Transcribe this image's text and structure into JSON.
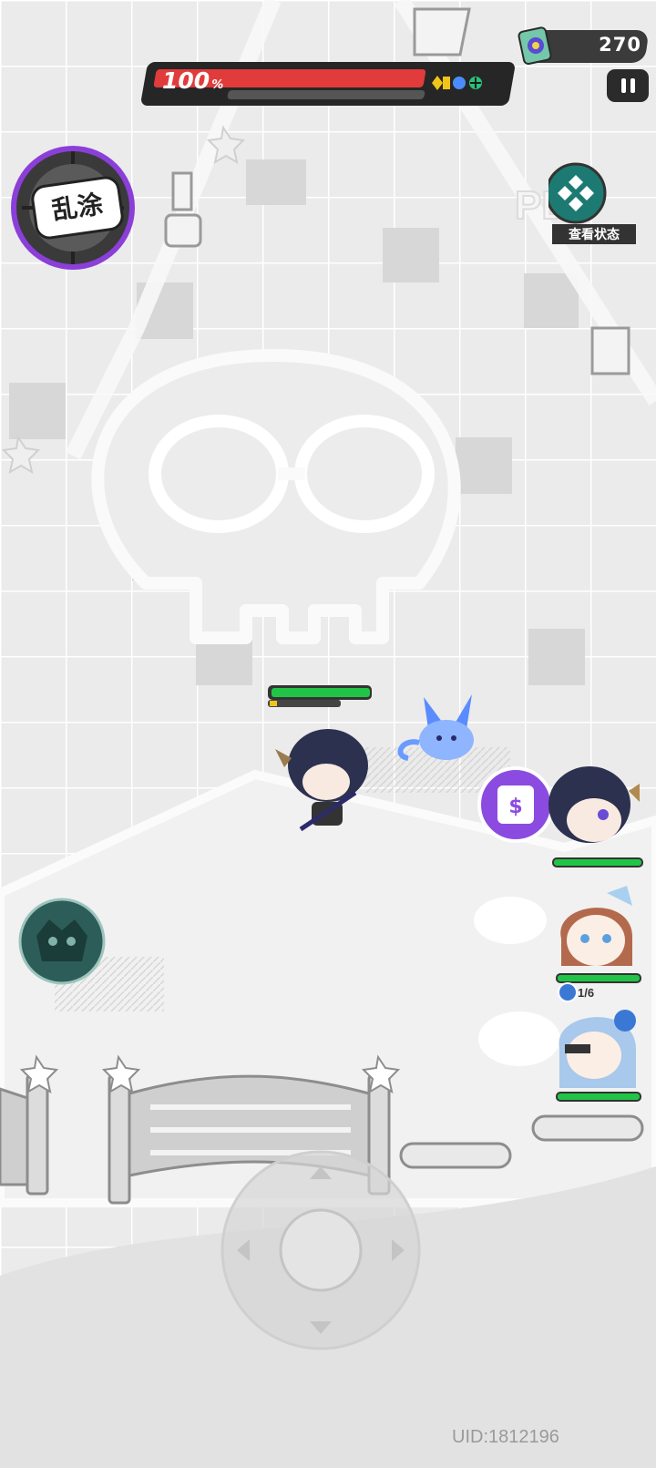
{
  "hud": {
    "currency": {
      "value": "270",
      "icon": "ticket-icon"
    },
    "hp": {
      "percent_label": "100",
      "percent_unit": "%",
      "percent": 100,
      "progress": 0.0
    },
    "skill_label": "乱涂",
    "view_status_label": "查看状态",
    "uid": "UID:1812196",
    "party": [
      {
        "name": "dark-hair-horned",
        "hp": 1.0
      },
      {
        "name": "brown-hair-ponytail",
        "hp": 1.0,
        "counter": "1/6"
      },
      {
        "name": "white-hair-masked",
        "hp": 1.0
      }
    ],
    "player_hp": 1.0,
    "colors": {
      "hp_red": "#e23b3b",
      "hp_green": "#22c447",
      "skill_purple": "#8b3fd8",
      "status_teal": "#1d7a72"
    }
  }
}
